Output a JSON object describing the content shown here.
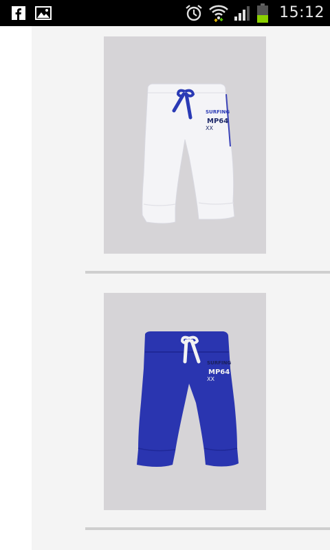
{
  "status_bar": {
    "time": "15:12",
    "icons": [
      "facebook-icon",
      "gallery-icon",
      "alarm-icon",
      "wifi-icon",
      "signal-icon",
      "battery-icon"
    ],
    "battery_level_fraction": 0.3,
    "signal_bars_filled": 3
  },
  "products": [
    {
      "name": "white-baby-jogger-pants",
      "color": "#f2f2f5",
      "accent": "#2c3db8",
      "print_lines": [
        "SURFING",
        "MP64",
        "XX"
      ]
    },
    {
      "name": "blue-baby-jogger-pants",
      "color": "#2a35b0",
      "accent": "#f2f2f2",
      "print_lines": [
        "SURFING",
        "MP64",
        "XX"
      ]
    }
  ],
  "colors": {
    "status_bar_bg": "#000000",
    "page_bg": "#f4f4f4",
    "photo_bg": "#d6d4d7",
    "separator": "#cfcfcf"
  }
}
